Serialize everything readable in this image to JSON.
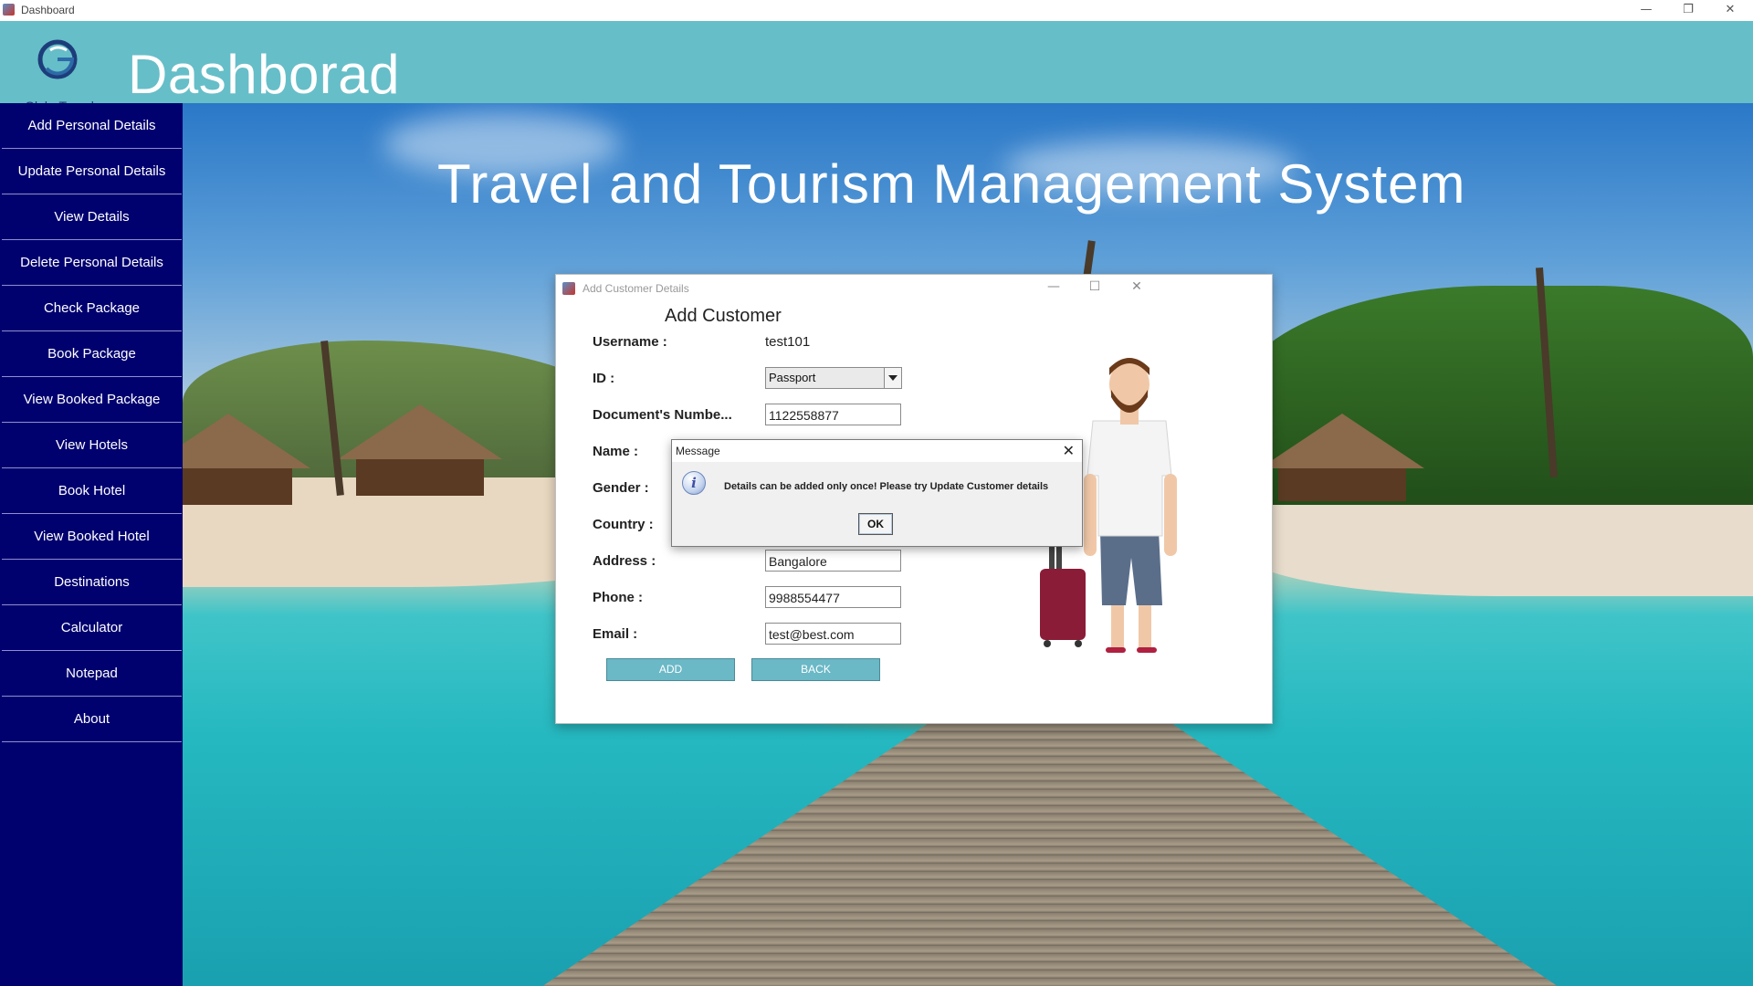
{
  "window": {
    "title": "Dashboard",
    "controls": {
      "minimize": "—",
      "restore": "❐",
      "close": "✕"
    }
  },
  "header": {
    "logo_text": "GlobeTravel",
    "title": "Dashborad"
  },
  "sidebar": {
    "items": [
      {
        "label": "Add Personal Details"
      },
      {
        "label": "Update Personal Details"
      },
      {
        "label": "View Details"
      },
      {
        "label": "Delete Personal Details"
      },
      {
        "label": "Check Package"
      },
      {
        "label": "Book Package"
      },
      {
        "label": "View Booked Package"
      },
      {
        "label": "View Hotels"
      },
      {
        "label": "Book Hotel"
      },
      {
        "label": "View Booked Hotel"
      },
      {
        "label": "Destinations"
      },
      {
        "label": "Calculator"
      },
      {
        "label": "Notepad"
      },
      {
        "label": "About"
      }
    ]
  },
  "main": {
    "banner_title": "Travel and Tourism Management System"
  },
  "add_customer": {
    "window_title": "Add Customer Details",
    "controls": {
      "minimize": "—",
      "maximize": "☐",
      "close": "✕"
    },
    "heading": "Add Customer",
    "fields": {
      "username_label": "Username  :",
      "username_value": "test101",
      "id_label": "ID  :",
      "id_value": "Passport",
      "doc_label": "Document's Numbe...",
      "doc_value": "1122558877",
      "name_label": "Name  :",
      "gender_label": "Gender  :",
      "country_label": "Country  :",
      "address_label": "Address  :",
      "address_value": "Bangalore",
      "phone_label": "Phone  :",
      "phone_value": "9988554477",
      "email_label": "Email  :",
      "email_value": "test@best.com"
    },
    "buttons": {
      "add": "ADD",
      "back": "BACK"
    }
  },
  "message_dialog": {
    "title": "Message",
    "close": "✕",
    "icon": "info-icon",
    "icon_glyph": "i",
    "text": "Details can be added only once! Please try Update Customer details",
    "ok": "OK"
  },
  "colors": {
    "header_bg": "#66bec8",
    "sidebar_bg": "#01006f",
    "button_bg": "#6bb8c6"
  }
}
